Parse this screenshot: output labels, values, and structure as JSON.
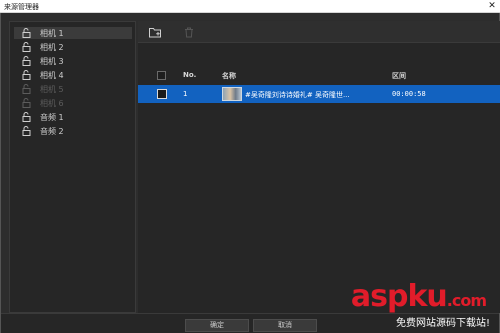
{
  "window": {
    "title": "来源管理器",
    "close_glyph": "✕"
  },
  "sidebar": {
    "items": [
      {
        "label": "相机 1",
        "selected": true,
        "dim": false
      },
      {
        "label": "相机 2",
        "selected": false,
        "dim": false
      },
      {
        "label": "相机 3",
        "selected": false,
        "dim": false
      },
      {
        "label": "相机 4",
        "selected": false,
        "dim": false
      },
      {
        "label": "相机 5",
        "selected": false,
        "dim": true
      },
      {
        "label": "相机 6",
        "selected": false,
        "dim": true
      },
      {
        "label": "音频 1",
        "selected": false,
        "dim": false
      },
      {
        "label": "音频 2",
        "selected": false,
        "dim": false
      }
    ]
  },
  "toolbar": {
    "add_icon": "folder-add-icon",
    "delete_icon": "trash-icon"
  },
  "table": {
    "columns": {
      "no": "No.",
      "name": "名称",
      "range": "区间"
    },
    "rows": [
      {
        "no": "1",
        "name": "#吴奇隆刘诗诗婚礼# 吴奇隆世...",
        "range": "00:00:58",
        "selected": true
      }
    ]
  },
  "footer": {
    "ok_label": "确定",
    "cancel_label": "取消"
  },
  "watermark": {
    "brand": "aspku",
    "suffix": ".com",
    "caption": "免费网站源码下载站!"
  },
  "colors": {
    "selection": "#1262c0",
    "watermark": "#e11c2a"
  }
}
